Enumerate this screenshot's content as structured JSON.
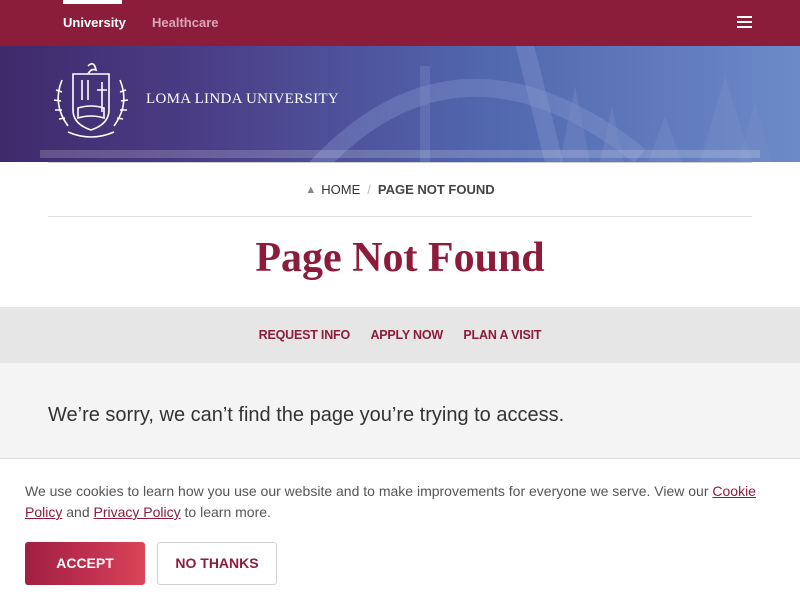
{
  "colors": {
    "brand": "#8c1d3a",
    "hero_gradient_start": "#3f2a6b",
    "hero_gradient_end": "#6c8ac8",
    "accept_gradient_end": "#d94658"
  },
  "topnav": {
    "tabs": [
      {
        "label": "University",
        "active": true
      },
      {
        "label": "Healthcare",
        "active": false
      }
    ],
    "menu_icon": "hamburger-icon"
  },
  "hero": {
    "logo_icon": "university-crest-icon",
    "logo_text": "LOMA LINDA UNIVERSITY"
  },
  "breadcrumb": {
    "home_icon": "home-icon",
    "home": "HOME",
    "separator": "/",
    "current": "PAGE NOT FOUND"
  },
  "page": {
    "title": "Page Not Found",
    "message": "We’re sorry, we can’t find the page you’re trying to access."
  },
  "actions": [
    "REQUEST INFO",
    "APPLY NOW",
    "PLAN A VISIT"
  ],
  "cookie": {
    "text_before": "We use cookies to learn how you use our website and to make improvements for everyone we serve. View our ",
    "cookie_policy": "Cookie Policy",
    "and": " and ",
    "privacy_policy": "Privacy Policy",
    "text_after": " to learn more.",
    "accept": "ACCEPT",
    "decline": "NO THANKS"
  }
}
